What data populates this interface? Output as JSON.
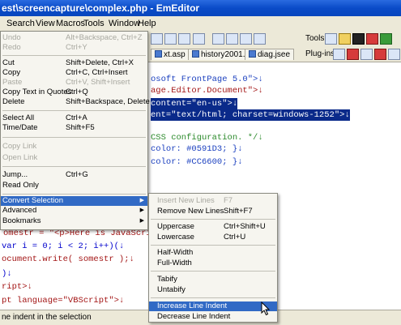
{
  "window": {
    "title": "est\\screencapture\\complex.php - EmEditor"
  },
  "menubar": {
    "items": [
      "Search",
      "View",
      "Macros",
      "Tools",
      "Window",
      "Help"
    ]
  },
  "toolbar": {
    "tools_label": "Tools",
    "plugins_label": "Plug-ins"
  },
  "tabs": [
    "xt.asp",
    "history2001.htm",
    "diag.jsee"
  ],
  "editor": {
    "lines": [
      "osoft FrontPage 5.0\">↓",
      "age.Editor.Document\">↓",
      "content=\"en-us\">↓",
      "ent=\"text/html; charset=windows-1252\">↓",
      "",
      "CSS configuration. */↓",
      "color: #0591D3; }↓",
      "color: #CC6600; }↓",
      "omestr = \"<p>Here is JavaScript",
      "var i = 0; i < 2; i++)(↓",
      "ocument.write( somestr );↓",
      ")↓",
      "ript>↓",
      "pt language=\"VBScript\">↓"
    ]
  },
  "edit_menu": {
    "items": [
      {
        "label": "Undo",
        "shortcut": "Alt+Backspace, Ctrl+Z",
        "disabled": true
      },
      {
        "label": "Redo",
        "shortcut": "Ctrl+Y",
        "disabled": true
      },
      {
        "label": "Cut",
        "shortcut": "Shift+Delete, Ctrl+X",
        "disabled": false
      },
      {
        "label": "Copy",
        "shortcut": "Ctrl+C, Ctrl+Insert",
        "disabled": false
      },
      {
        "label": "Paste",
        "shortcut": "Ctrl+V, Shift+Insert",
        "disabled": true
      },
      {
        "label": "Copy Text in Quotes",
        "shortcut": "Ctrl+Q",
        "disabled": false
      },
      {
        "label": "Delete",
        "shortcut": "Shift+Backspace, Delete",
        "disabled": false
      },
      {
        "label": "Select All",
        "shortcut": "Ctrl+A",
        "disabled": false
      },
      {
        "label": "Time/Date",
        "shortcut": "Shift+F5",
        "disabled": false
      },
      {
        "label": "Copy Link",
        "shortcut": "",
        "disabled": true
      },
      {
        "label": "Open Link",
        "shortcut": "",
        "disabled": true
      },
      {
        "label": "Jump...",
        "shortcut": "Ctrl+G",
        "disabled": false
      },
      {
        "label": "Read Only",
        "shortcut": "",
        "disabled": false
      },
      {
        "label": "Convert Selection",
        "shortcut": "",
        "disabled": false
      },
      {
        "label": "Advanced",
        "shortcut": "",
        "disabled": false
      },
      {
        "label": "Bookmarks",
        "shortcut": "",
        "disabled": false
      }
    ]
  },
  "convert_menu": {
    "items": [
      {
        "label": "Insert New Lines",
        "shortcut": "F7",
        "disabled": true
      },
      {
        "label": "Remove New Lines",
        "shortcut": "Shift+F7",
        "disabled": false
      },
      {
        "label": "Uppercase",
        "shortcut": "Ctrl+Shift+U",
        "disabled": false
      },
      {
        "label": "Lowercase",
        "shortcut": "Ctrl+U",
        "disabled": false
      },
      {
        "label": "Half-Width",
        "shortcut": "",
        "disabled": false
      },
      {
        "label": "Full-Width",
        "shortcut": "",
        "disabled": false
      },
      {
        "label": "Tabify",
        "shortcut": "",
        "disabled": false
      },
      {
        "label": "Untabify",
        "shortcut": "",
        "disabled": false
      },
      {
        "label": "Increase Line Indent",
        "shortcut": "",
        "disabled": false
      },
      {
        "label": "Decrease Line Indent",
        "shortcut": "",
        "disabled": false
      }
    ]
  },
  "statusbar": {
    "text": "ne indent in the selection"
  },
  "colors": {
    "accent": "#316ac5",
    "titlebar": "#0a4bc8",
    "selection": "#0a2a8a"
  }
}
